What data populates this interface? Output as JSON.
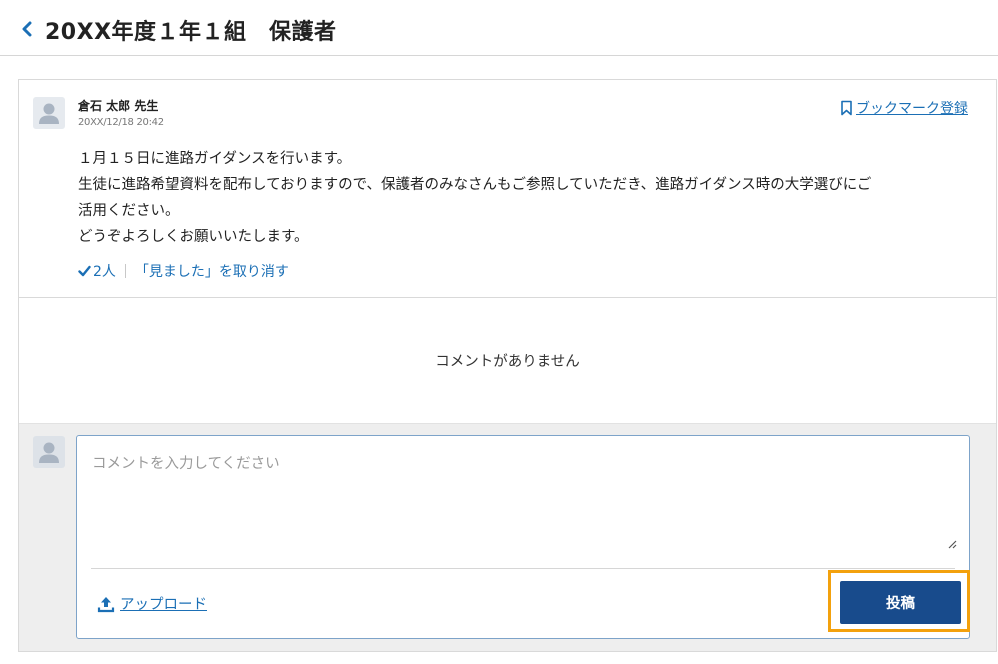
{
  "header": {
    "title": "20XX年度１年１組　保護者"
  },
  "post": {
    "author": "倉石 太郎 先生",
    "date": "20XX/12/18 20:42",
    "bookmark_label": "ブックマーク登録",
    "body": [
      "１月１５日に進路ガイダンスを行います。",
      "生徒に進路希望資料を配布しておりますので、保護者のみなさんもご参照していただき、進路ガイダンス時の大学選びにご",
      "活用ください。",
      "どうぞよろしくお願いいたします。"
    ],
    "seen_count": "2人",
    "undo_seen_label": "「見ました」を取り消す"
  },
  "comments": {
    "empty_message": "コメントがありません"
  },
  "compose": {
    "placeholder": "コメントを入力してください",
    "upload_label": "アップロード",
    "submit_label": "投稿"
  },
  "colors": {
    "link": "#1b6fb5",
    "primary_button": "#184b8c",
    "highlight_frame": "#f3a10d"
  }
}
